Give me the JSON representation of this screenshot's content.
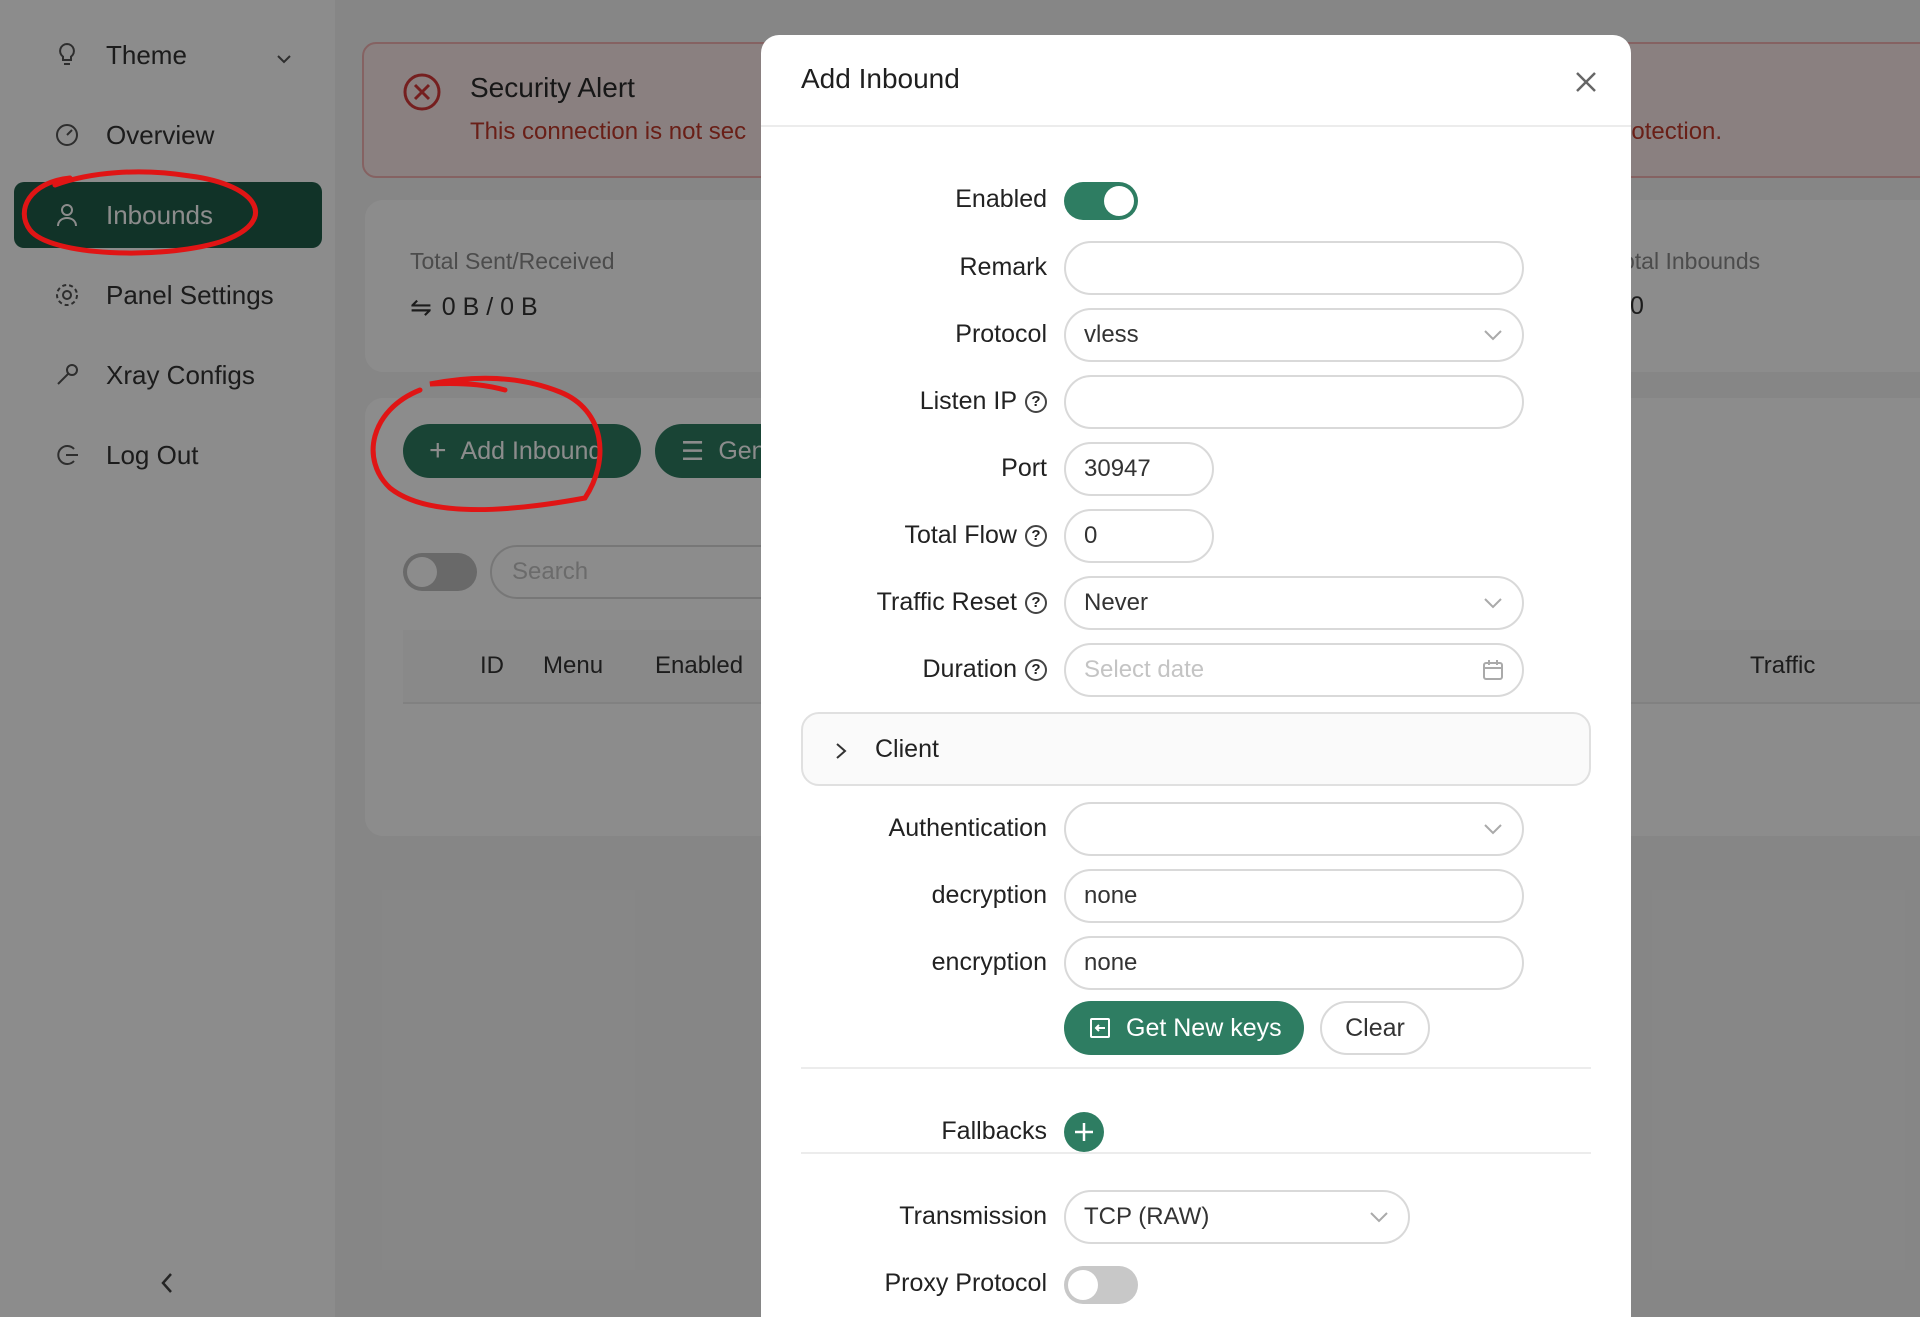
{
  "sidebar": {
    "items": [
      {
        "label": "Theme",
        "icon": "bulb-icon"
      },
      {
        "label": "Overview",
        "icon": "dashboard-icon"
      },
      {
        "label": "Inbounds",
        "icon": "user-icon"
      },
      {
        "label": "Panel Settings",
        "icon": "gear-icon"
      },
      {
        "label": "Xray Configs",
        "icon": "tool-icon"
      },
      {
        "label": "Log Out",
        "icon": "logout-icon"
      }
    ],
    "active": "Inbounds"
  },
  "alert": {
    "title": "Security Alert",
    "text_left": "This connection is not sec",
    "text_right": "protection."
  },
  "stats": {
    "sent_label": "Total Sent/Received",
    "sent_value": "0 B / 0 B",
    "inbounds_label": "otal Inbounds",
    "inbounds_value": "0"
  },
  "toolbar": {
    "add_inbound": "Add Inbound",
    "general": "Gen",
    "search_placeholder": "Search"
  },
  "table": {
    "columns": [
      "ID",
      "Menu",
      "Enabled",
      "Traffic"
    ]
  },
  "modal": {
    "title": "Add Inbound",
    "fields": {
      "enabled_label": "Enabled",
      "remark_label": "Remark",
      "remark_value": "",
      "protocol_label": "Protocol",
      "protocol_value": "vless",
      "listen_ip_label": "Listen IP",
      "listen_ip_value": "",
      "port_label": "Port",
      "port_value": "30947",
      "total_flow_label": "Total Flow",
      "total_flow_value": "0",
      "traffic_reset_label": "Traffic Reset",
      "traffic_reset_value": "Never",
      "duration_label": "Duration",
      "duration_placeholder": "Select date",
      "client_label": "Client",
      "authentication_label": "Authentication",
      "authentication_value": "",
      "decryption_label": "decryption",
      "decryption_value": "none",
      "encryption_label": "encryption",
      "encryption_value": "none",
      "get_keys_label": "Get New keys",
      "clear_label": "Clear",
      "fallbacks_label": "Fallbacks",
      "transmission_label": "Transmission",
      "transmission_value": "TCP (RAW)",
      "proxy_protocol_label": "Proxy Protocol"
    },
    "enabled": true,
    "proxy_protocol": false
  },
  "colors": {
    "accent": "#2e7d62",
    "active_nav": "#1f5e49",
    "alert_text": "#c0392b",
    "annotation": "#e01515"
  }
}
